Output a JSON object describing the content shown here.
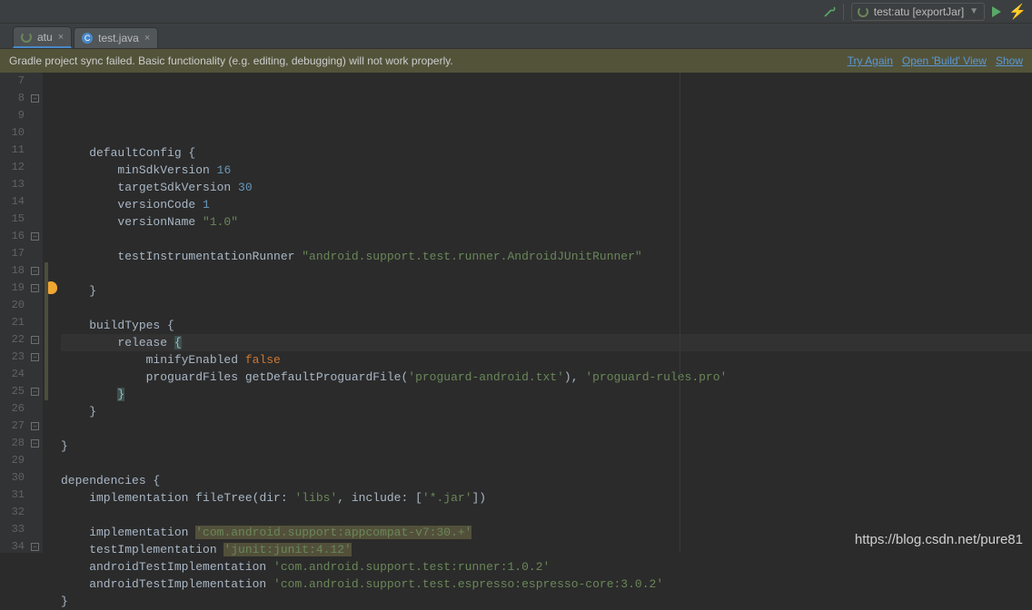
{
  "toolbar": {
    "run_config": "test:atu [exportJar]"
  },
  "tabs": [
    {
      "label": "atu",
      "type": "gradle",
      "active": true
    },
    {
      "label": "test.java",
      "type": "java",
      "active": false
    }
  ],
  "notification": {
    "message": "Gradle project sync failed. Basic functionality (e.g. editing, debugging) will not work properly.",
    "links": [
      "Try Again",
      "Open 'Build' View",
      "Show"
    ]
  },
  "gutter": {
    "start": 7,
    "end": 34
  },
  "code_tokens": {
    "l8": {
      "plain": "defaultConfig {"
    },
    "l9": {
      "a": "minSdkVersion ",
      "num": "16"
    },
    "l10": {
      "a": "targetSdkVersion ",
      "num": "30"
    },
    "l11": {
      "a": "versionCode ",
      "num": "1"
    },
    "l12": {
      "a": "versionName ",
      "str": "\"1.0\""
    },
    "l14": {
      "a": "testInstrumentationRunner ",
      "str": "\"android.support.test.runner.AndroidJUnitRunner\""
    },
    "l16": {
      "plain": "}"
    },
    "l18": {
      "plain": "buildTypes {"
    },
    "l19": {
      "a": "release ",
      "brace": "{"
    },
    "l20": {
      "a": "minifyEnabled ",
      "kw": "false"
    },
    "l21": {
      "a": "proguardFiles getDefaultProguardFile(",
      "s1": "'proguard-android.txt'",
      "b": "), ",
      "s2": "'proguard-rules.pro'"
    },
    "l22": {
      "brace": "}"
    },
    "l23": {
      "plain": "}"
    },
    "l25": {
      "plain": "}"
    },
    "l27": {
      "plain": "dependencies {"
    },
    "l28": {
      "a": "implementation fileTree(",
      "p1": "dir: ",
      "s1": "'libs'",
      "p2": ", include: [",
      "s2": "'*.jar'",
      "p3": "])"
    },
    "l30": {
      "a": "implementation ",
      "warn": "'com.android.support:appcompat-v7:30.+'"
    },
    "l31": {
      "a": "testImplementation ",
      "warn": "'junit:junit:4.12'"
    },
    "l32": {
      "a": "androidTestImplementation ",
      "str": "'com.android.support.test:runner:1.0.2'"
    },
    "l33": {
      "a": "androidTestImplementation ",
      "str": "'com.android.support.test.espresso:espresso-core:3.0.2'"
    },
    "l34": {
      "plain": "}"
    }
  },
  "watermark": "https://blog.csdn.net/pure81"
}
